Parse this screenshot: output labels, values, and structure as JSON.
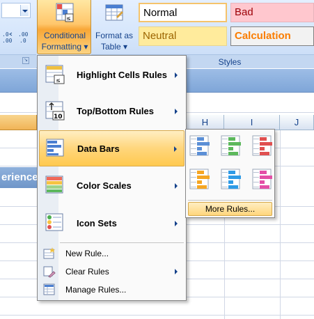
{
  "ribbon": {
    "number_format_value": "",
    "increase_decimal_label": "←.0\n.00",
    "decrease_decimal_label": ".00\n→.0",
    "conditional_formatting_label_line1": "Conditional",
    "conditional_formatting_label_line2": "Formatting ▾",
    "format_as_table_label_line1": "Format as",
    "format_as_table_label_line2": "Table ▾",
    "styles": {
      "normal": "Normal",
      "bad": "Bad",
      "neutral": "Neutral",
      "calculation": "Calculation"
    },
    "styles_group_label": "Styles"
  },
  "sheet": {
    "columns": [
      "H",
      "I",
      "J"
    ],
    "partial_header_text": "erience"
  },
  "cf_menu": {
    "items": [
      {
        "label": "Highlight Cells Rules",
        "icon": "highlight-cells-icon",
        "has_submenu": true
      },
      {
        "label": "Top/Bottom Rules",
        "icon": "top-bottom-icon",
        "has_submenu": true
      },
      {
        "label": "Data Bars",
        "icon": "data-bars-icon",
        "has_submenu": true,
        "active": true
      },
      {
        "label": "Color Scales",
        "icon": "color-scales-icon",
        "has_submenu": true
      },
      {
        "label": "Icon Sets",
        "icon": "icon-sets-icon",
        "has_submenu": true
      },
      {
        "label": "New Rule...",
        "icon": "new-rule-icon",
        "has_submenu": false
      },
      {
        "label": "Clear Rules",
        "icon": "clear-rules-icon",
        "has_submenu": true
      },
      {
        "label": "Manage Rules...",
        "icon": "manage-rules-icon",
        "has_submenu": false
      }
    ]
  },
  "data_bars_menu": {
    "swatches": [
      {
        "name": "blue-data-bar",
        "color": "#5b8fd6"
      },
      {
        "name": "green-data-bar",
        "color": "#5cb85c"
      },
      {
        "name": "red-data-bar",
        "color": "#e05050"
      },
      {
        "name": "orange-data-bar",
        "color": "#f5a623"
      },
      {
        "name": "light-blue-data-bar",
        "color": "#2e9be6"
      },
      {
        "name": "purple-data-bar",
        "color": "#e44fa6"
      }
    ],
    "more_rules_label": "More Rules..."
  }
}
